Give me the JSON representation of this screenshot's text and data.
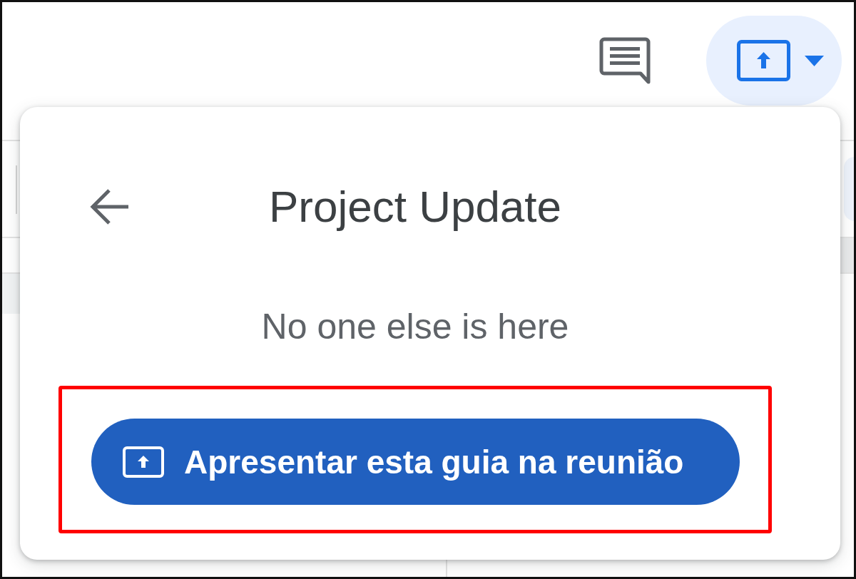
{
  "present_menu_button": {
    "expanded": true
  },
  "popup": {
    "title": "Project Update",
    "status": "No one else is here",
    "action": {
      "label": "Apresentar esta guia na reunião",
      "highlighted": true
    }
  }
}
